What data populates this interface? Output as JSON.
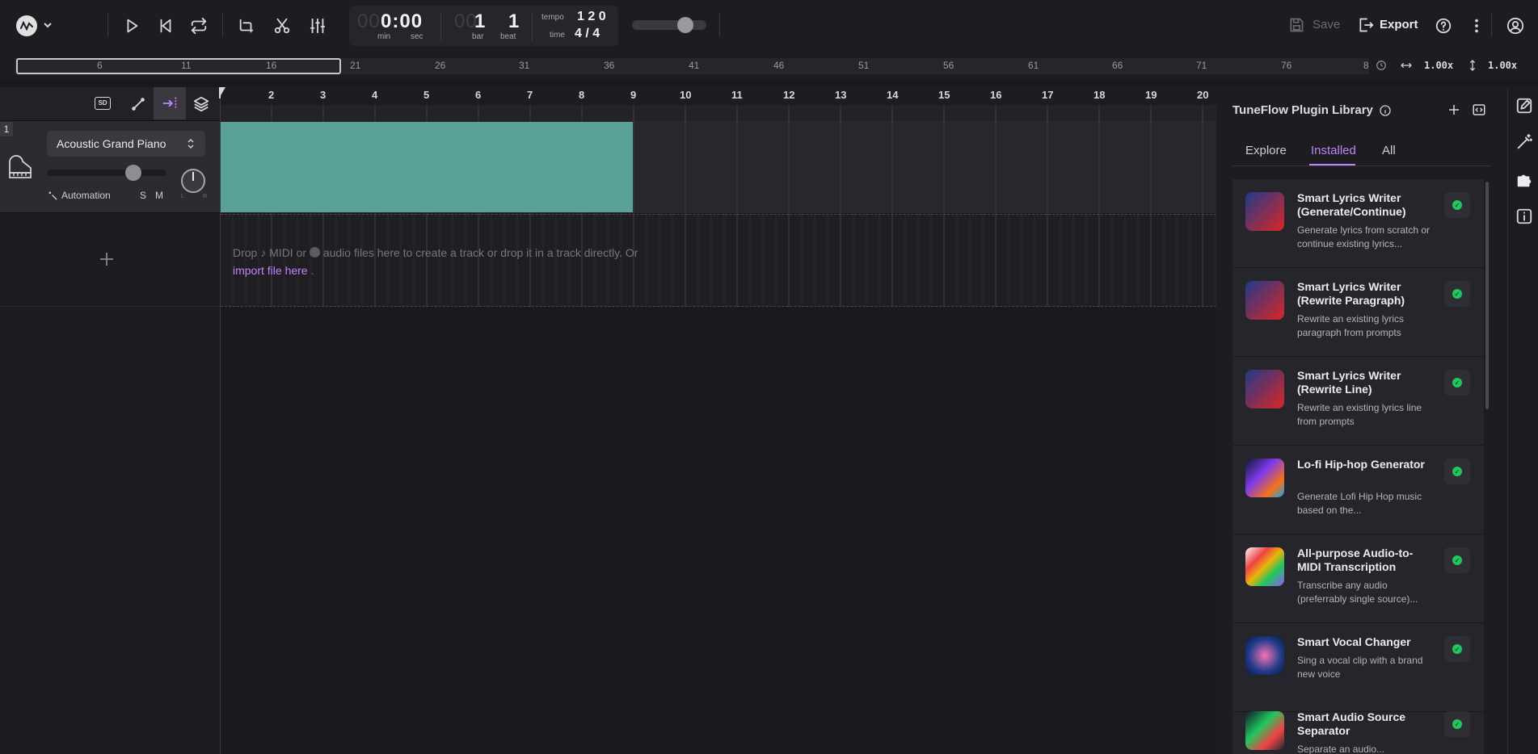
{
  "clock": {
    "min_dim": "00",
    "min_sec": "0:00",
    "min_label": "min",
    "sec_label": "sec",
    "bar_dim": "00",
    "bar": "1",
    "beat": "1",
    "bar_label": "bar",
    "beat_label": "beat",
    "tempo_label": "tempo",
    "tempo": "1 2 0",
    "time_label": "time",
    "time_sig": "4 / 4"
  },
  "toolbar": {
    "save_label": "Save",
    "export_label": "Export"
  },
  "overview": {
    "numbers": [
      "6",
      "11",
      "16",
      "21",
      "26",
      "31",
      "36",
      "41",
      "46",
      "51",
      "56",
      "61",
      "66",
      "71",
      "76",
      "8"
    ],
    "zoom_x": "1.00x",
    "zoom_y": "1.00x"
  },
  "ruler": {
    "bars": [
      "2",
      "3",
      "4",
      "5",
      "6",
      "7",
      "8",
      "9",
      "10",
      "11",
      "12",
      "13",
      "14",
      "15",
      "16",
      "17",
      "18",
      "19",
      "20"
    ]
  },
  "track": {
    "index": "1",
    "instrument": "Acoustic Grand Piano",
    "automation_label": "Automation",
    "solo_label": "S",
    "mute_label": "M",
    "pan_left": "L",
    "pan_right": "R",
    "volume": 0.72
  },
  "dropzone": {
    "part1": "Drop",
    "midi": "MIDI or",
    "part2": "audio files here to create a track or drop it in a track directly. Or",
    "link": "import file here",
    "end": "."
  },
  "panel": {
    "title": "TuneFlow Plugin Library",
    "tabs": [
      "Explore",
      "Installed",
      "All"
    ],
    "active_tab": "Installed",
    "plugins": [
      {
        "title": "Smart Lyrics Writer (Generate/Continue)",
        "desc": "Generate lyrics from scratch or continue existing lyrics..."
      },
      {
        "title": "Smart Lyrics Writer (Rewrite Paragraph)",
        "desc": "Rewrite an existing lyrics paragraph from prompts"
      },
      {
        "title": "Smart Lyrics Writer (Rewrite Line)",
        "desc": "Rewrite an existing lyrics line from prompts"
      },
      {
        "title": "Lo-fi Hip-hop Generator",
        "desc": "Generate Lofi Hip Hop music based on the..."
      },
      {
        "title": "All-purpose Audio-to-MIDI Transcription",
        "desc": "Transcribe any audio (preferrably single source)..."
      },
      {
        "title": "Smart Vocal Changer",
        "desc": "Sing a vocal clip with a brand new voice"
      },
      {
        "title": "Smart Audio Source Separator",
        "desc": "Separate an audio..."
      }
    ]
  },
  "colors": {
    "accent": "#c084fc",
    "clip": "#5aa295",
    "installed_check": "#22c55e"
  }
}
